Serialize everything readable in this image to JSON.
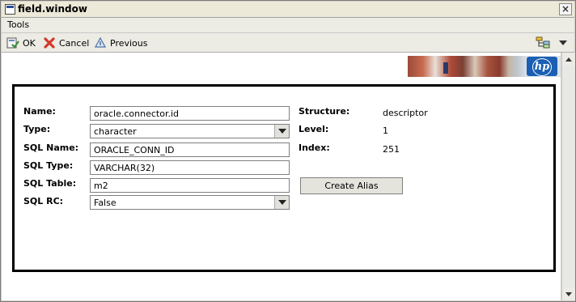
{
  "window": {
    "title": "field.window"
  },
  "menubar": {
    "items": [
      {
        "label": "Tools"
      }
    ]
  },
  "toolbar": {
    "ok_label": "OK",
    "cancel_label": "Cancel",
    "previous_label": "Previous"
  },
  "form": {
    "name": {
      "label": "Name:",
      "value": "oracle.connector.id"
    },
    "type": {
      "label": "Type:",
      "value": "character"
    },
    "sql_name": {
      "label": "SQL Name:",
      "value": "ORACLE_CONN_ID"
    },
    "sql_type": {
      "label": "SQL Type:",
      "value": "VARCHAR(32)"
    },
    "sql_table": {
      "label": "SQL Table:",
      "value": "m2"
    },
    "sql_rc": {
      "label": "SQL RC:",
      "value": "False"
    },
    "structure": {
      "label": "Structure:",
      "value": "descriptor"
    },
    "level": {
      "label": "Level:",
      "value": "1"
    },
    "index": {
      "label": "Index:",
      "value": "251"
    },
    "create_alias_label": "Create Alias"
  },
  "branding": {
    "logo_text": "hp"
  },
  "colors": {
    "hp_blue": "#1a5fb4",
    "cancel_red": "#d23a2a",
    "ok_green": "#3f8f3f"
  },
  "icons": [
    "window-icon",
    "close-icon",
    "ok-icon",
    "cancel-icon",
    "previous-icon",
    "tree-view-icon",
    "chevron-down-icon"
  ]
}
